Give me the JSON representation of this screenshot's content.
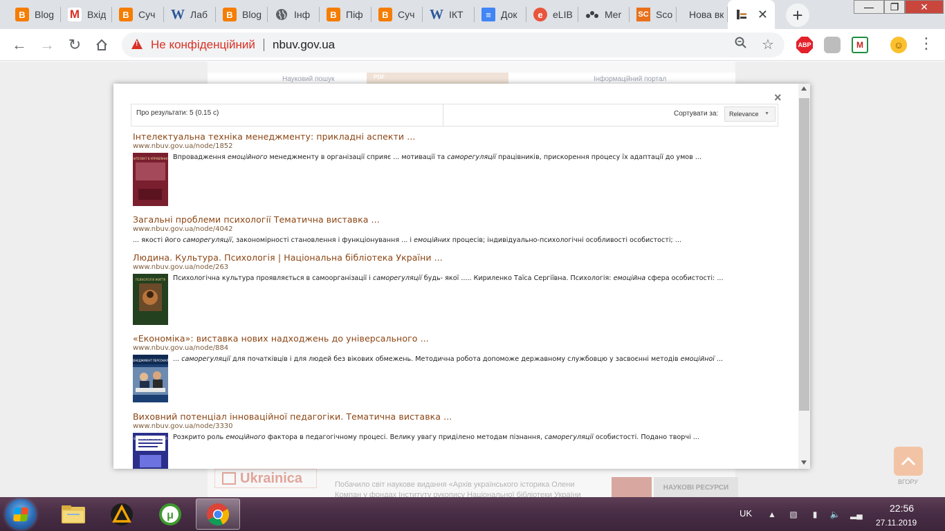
{
  "browser": {
    "tabs": [
      {
        "title": "Blog",
        "icon": "blogger-icon"
      },
      {
        "title": "Вхід",
        "icon": "gmail-icon"
      },
      {
        "title": "Суч",
        "icon": "blogger-icon"
      },
      {
        "title": "Лаб",
        "icon": "word-icon"
      },
      {
        "title": "Blog",
        "icon": "blogger-icon"
      },
      {
        "title": "Інф",
        "icon": "globe-icon"
      },
      {
        "title": "Піф",
        "icon": "blogger-icon"
      },
      {
        "title": "Суч",
        "icon": "blogger-icon"
      },
      {
        "title": "ІКТ",
        "icon": "word-icon"
      },
      {
        "title": "Док",
        "icon": "docs-icon"
      },
      {
        "title": "eLIB",
        "icon": "elibrary-icon"
      },
      {
        "title": "Mer",
        "icon": "mendeley-icon"
      },
      {
        "title": "Sco",
        "icon": "scopus-icon"
      },
      {
        "title": "Нова вк",
        "icon": "none"
      },
      {
        "title": "",
        "icon": "nbuv-icon",
        "active": true
      }
    ],
    "new_tab_symbol": "+",
    "window_controls": {
      "minimize": "—",
      "maximize": "❐",
      "close": "✕"
    },
    "tab_close_symbol": "✕",
    "security_label": "Не конфіденційний",
    "url": "nbuv.gov.ua",
    "extension_abp": "ABP",
    "accent_color": "#d93025"
  },
  "page": {
    "top_left_text": "Науковий пошук",
    "top_right_text": "Інформаційний портал",
    "pdf_badge": "PDF",
    "ukrainica": "Ukrainica",
    "news_snippet": "Побачило світ наукове видання «Архів українського історика Олени Компан у фондах Інституту рукопису Національної бібліотеки України імені В. І.",
    "resources_label": "НАУКОВІ РЕСУРСИ",
    "scroll_top_label": "ВГОРУ"
  },
  "search_modal": {
    "results_stat": "Про результати: 5 (0.15 с)",
    "sort_label": "Сортувати за:",
    "sort_value": "Relevance",
    "close_symbol": "×",
    "results": [
      {
        "title": "Інтелектуальна техніка менеджменту: прикладні аспекти ...",
        "url": "www.nbuv.gov.ua/node/1852",
        "snippet_parts": [
          {
            "t": "Впровадження "
          },
          {
            "t": "емоційного",
            "em": true
          },
          {
            "t": " менеджменту в організації сприяє ... мотивації та "
          },
          {
            "t": "саморегуляції",
            "em": true
          },
          {
            "t": " працівників, прискорення процесу їх адаптації до умов ..."
          }
        ],
        "thumb": "book-cover-management",
        "cover_text": "ІНТЕЛЕКТ В УПРАВЛІННІ"
      },
      {
        "title": "Загальні проблеми психології Тематична виставка ...",
        "url": "www.nbuv.gov.ua/node/4042",
        "snippet_parts": [
          {
            "t": "... якості його "
          },
          {
            "t": "саморегуляції",
            "em": true
          },
          {
            "t": ", закономірності становлення і функціонування ... і "
          },
          {
            "t": "емоційних",
            "em": true
          },
          {
            "t": " процесів; індивідуально-психологічні особливості особистості; ..."
          }
        ],
        "thumb": "none"
      },
      {
        "title": "Людина. Культура. Психологія | Національна бібліотека України ...",
        "url": "www.nbuv.gov.ua/node/263",
        "snippet_parts": [
          {
            "t": "Психологічна культура проявляється в самоорганізації і "
          },
          {
            "t": "саморегуляції",
            "em": true
          },
          {
            "t": " будь- якої ..... Кириленко Таїса Сергіївна. Психологія: "
          },
          {
            "t": "емоційна",
            "em": true
          },
          {
            "t": " сфера особистості:  ..."
          }
        ],
        "thumb": "book-cover-psychology",
        "cover_text": "ПСИХОЛОГІЯ ЖИТТЯ"
      },
      {
        "title": "«Економіка»: виставка нових надходжень до універсального ...",
        "url": "www.nbuv.gov.ua/node/884",
        "snippet_parts": [
          {
            "t": "... "
          },
          {
            "t": "саморегуляції",
            "em": true
          },
          {
            "t": " для початківців і для людей без вікових обмежень. Методична робота допоможе державному службовцю у засвоєнні методів "
          },
          {
            "t": "емоційної",
            "em": true
          },
          {
            "t": " ..."
          }
        ],
        "thumb": "book-cover-personnel",
        "cover_text": "МЕНЕДЖМЕНТ ПЕРСОНАЛУ"
      },
      {
        "title": "Виховний потенціал інноваційної педагогіки. Тематична виставка ...",
        "url": "www.nbuv.gov.ua/node/3330",
        "snippet_parts": [
          {
            "t": "Розкрито роль "
          },
          {
            "t": "емоційного",
            "em": true
          },
          {
            "t": " фактора в педагогічному процесі. Велику увагу приділено методам пізнання, "
          },
          {
            "t": "саморегуляції",
            "em": true
          },
          {
            "t": " особистості. Подано творчі ..."
          }
        ],
        "thumb": "book-cover-pedagogy",
        "cover_text": "ВИХОВНИЙ ПОТЕНЦІАЛ"
      }
    ]
  },
  "taskbar": {
    "apps": [
      {
        "name": "explorer"
      },
      {
        "name": "aimp"
      },
      {
        "name": "utorrent"
      },
      {
        "name": "chrome",
        "active": true
      }
    ],
    "language": "UK",
    "time": "22:56",
    "date": "27.11.2019"
  }
}
